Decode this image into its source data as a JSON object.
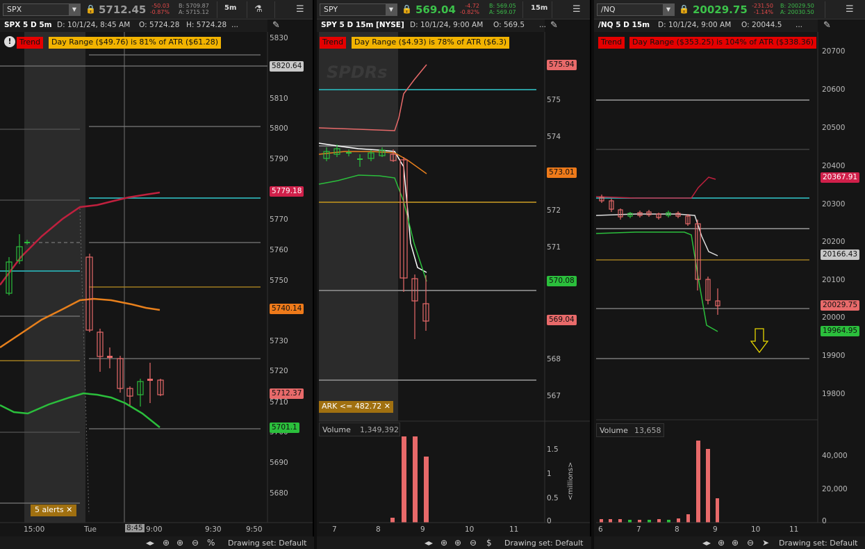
{
  "panels": [
    {
      "symbol": "SPX",
      "price": "5712.45",
      "price_color": "#9a9a9a",
      "change": "-50.03",
      "change_pct": "-0.87%",
      "bid": "B: 5709.87",
      "ask": "A: 5715.12",
      "timeframe": "5m",
      "info": {
        "title": "SPX 5 D 5m",
        "date": "D: 10/1/24, 8:45 AM",
        "open": "O: 5724.28",
        "high": "H: 5724.28",
        "more": "..."
      },
      "trend": "Trend",
      "range_text": "Day Range ($49.76) is 81% of ATR ($61.28)",
      "y_ticks": [
        "5830",
        "5820",
        "5810",
        "5800",
        "5790",
        "5780",
        "5770",
        "5760",
        "5750",
        "5740",
        "5730",
        "5720",
        "5710",
        "5700",
        "5690",
        "5680"
      ],
      "price_tags": [
        {
          "text": "5820.64",
          "bg": "#c8c8c8"
        },
        {
          "text": "5779.18",
          "bg": "#d0204a"
        },
        {
          "text": "5740.14",
          "bg": "#ee7a1a"
        },
        {
          "text": "5712.37",
          "bg": "#e86a6a"
        },
        {
          "text": "5701.1",
          "bg": "#2bbf3c"
        }
      ],
      "time_labels": [
        "15:00",
        "Tue",
        "8:45",
        "9:00",
        "9:30",
        "9:50"
      ],
      "alerts": "5 alerts ✕",
      "drawing_set": "Drawing set: Default"
    },
    {
      "symbol": "SPY",
      "price": "569.04",
      "price_color": "#3cc24a",
      "change": "-4.72",
      "change_pct": "-0.82%",
      "bid": "B: 569.05",
      "ask": "A: 569.07",
      "timeframe": "15m",
      "info": {
        "title": "SPY 5 D 15m [NYSE]",
        "date": "D: 10/1/24, 9:00 AM",
        "open": "O: 569.5",
        "more": "..."
      },
      "trend": "Trend",
      "range_text": "Day Range ($4.93) is 78% of ATR ($6.3)",
      "watermark": "SPDRs",
      "y_ticks": [
        "575",
        "574",
        "573",
        "572",
        "571",
        "570",
        "569",
        "568",
        "567"
      ],
      "price_tags": [
        {
          "text": "575.94",
          "bg": "#e86a6a"
        },
        {
          "text": "573.01",
          "bg": "#ee7a1a"
        },
        {
          "text": "570.08",
          "bg": "#2bbf3c"
        },
        {
          "text": "569.04",
          "bg": "#e86a6a"
        }
      ],
      "ark_label": "ARK <= 482.72 ✕",
      "volume_label": "Volume",
      "volume_value": "1,349,392",
      "volume_ticks": [
        "1.5",
        "1",
        "0.5",
        "0"
      ],
      "volume_unit": "<millions>",
      "time_labels": [
        "7",
        "8",
        "9",
        "10",
        "11"
      ],
      "drawing_set": "Drawing set: Default"
    },
    {
      "symbol": "/NQ",
      "price": "20029.75",
      "price_color": "#3cc24a",
      "change": "-231.50",
      "change_pct": "-1.14%",
      "bid": "B: 20029.50",
      "ask": "A: 20030.50",
      "info": {
        "title": "/NQ 5 D 15m",
        "date": "D: 10/1/24, 9:00 AM",
        "open": "O: 20044.5",
        "more": "..."
      },
      "trend": "Trend",
      "range_text": "Day Range ($353.25) is 104% of ATR ($338.36)",
      "y_ticks": [
        "20700",
        "20600",
        "20500",
        "20400",
        "20300",
        "20200",
        "20100",
        "20000",
        "19900",
        "19800"
      ],
      "price_tags": [
        {
          "text": "20367.91",
          "bg": "#d0204a"
        },
        {
          "text": "20166.43",
          "bg": "#c8c8c8"
        },
        {
          "text": "20029.75",
          "bg": "#e86a6a"
        },
        {
          "text": "19964.95",
          "bg": "#2bbf3c"
        }
      ],
      "volume_label": "Volume",
      "volume_value": "13,658",
      "volume_ticks": [
        "40,000",
        "20,000",
        "0"
      ],
      "time_labels": [
        "6",
        "7",
        "8",
        "9",
        "10",
        "11"
      ],
      "drawing_set": "Drawing set: Default"
    }
  ],
  "icons": {
    "lock": "lock-icon",
    "menu": "hamburger-menu-icon",
    "style": "chart-style-icon",
    "drawing": "drawing-tool-icon",
    "zoom_in": "zoom-in-icon",
    "zoom_out": "zoom-out-icon",
    "crosshair": "crosshair-icon",
    "pan": "pan-arrows-icon",
    "percent": "percent-icon",
    "dollar": "dollar-icon",
    "cursor": "cursor-icon"
  },
  "colors": {
    "bg": "#151515",
    "up": "#2bbf3c",
    "down": "#e86a6a",
    "ema_red": "#c0203e",
    "ema_orange": "#e8801c",
    "ema_green": "#2bbf3c",
    "teal": "#2a9da0"
  }
}
